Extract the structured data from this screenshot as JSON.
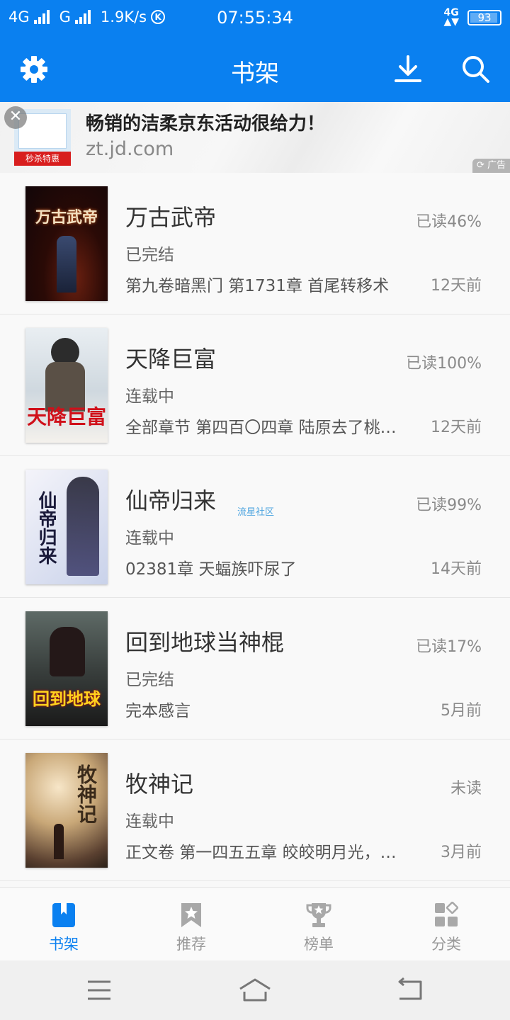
{
  "status_bar": {
    "network1": "4G",
    "network2": "G",
    "speed": "1.9K/s",
    "k_icon": "K",
    "time": "07:55:34",
    "net_type": "4G",
    "battery": "93"
  },
  "app_bar": {
    "title": "书架",
    "icons": [
      "settings-icon",
      "download-icon",
      "search-icon"
    ]
  },
  "ad": {
    "headline": "畅销的洁柔京东活动很给力！",
    "url": "zt.jd.com",
    "image_band": "秒杀特惠",
    "close": "✕",
    "tag": "广告"
  },
  "books": [
    {
      "title": "万古武帝",
      "status": "已完结",
      "chapter": "第九卷暗黑门 第1731章 首尾转移术",
      "progress": "已读46%",
      "updated": "12天前",
      "cover_text": "万古武帝"
    },
    {
      "title": "天降巨富",
      "status": "连载中",
      "chapter": "全部章节 第四百〇四章 陆原去了桃…",
      "progress": "已读100%",
      "updated": "12天前",
      "cover_text": "天降巨富"
    },
    {
      "title": "仙帝归来",
      "status": "连载中",
      "chapter": "02381章 天蝠族吓尿了",
      "progress": "已读99%",
      "updated": "14天前",
      "cover_text": "仙帝归来"
    },
    {
      "title": "回到地球当神棍",
      "status": "已完结",
      "chapter": "完本感言",
      "progress": "已读17%",
      "updated": "5月前",
      "cover_text": "回到地球"
    },
    {
      "title": "牧神记",
      "status": "连载中",
      "chapter": "正文卷 第一四五五章 皎皎明月光，…",
      "progress": "未读",
      "updated": "3月前",
      "cover_text": "牧神记"
    }
  ],
  "watermark": "流星社区",
  "tabs": [
    {
      "label": "书架",
      "icon": "bookshelf-icon",
      "active": true
    },
    {
      "label": "推荐",
      "icon": "bookmark-star-icon",
      "active": false
    },
    {
      "label": "榜单",
      "icon": "trophy-icon",
      "active": false
    },
    {
      "label": "分类",
      "icon": "category-grid-icon",
      "active": false
    }
  ],
  "colors": {
    "primary": "#0a80f0",
    "text": "#333333",
    "muted": "#8a8a8a",
    "tab_inactive": "#999999"
  }
}
